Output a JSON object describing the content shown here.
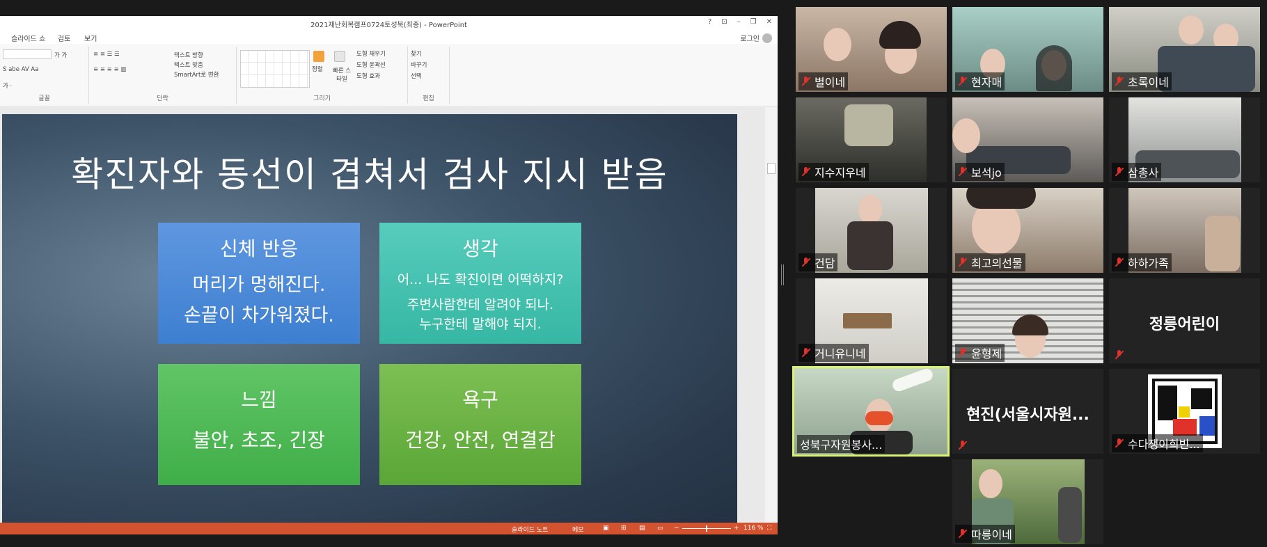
{
  "ppt": {
    "window_title": "2021재난회복캠프0724토성북(최종) - PowerPoint",
    "win_help": "?",
    "win_min": "–",
    "win_restore": "❐",
    "win_close": "✕",
    "menu": [
      "슬라이드 쇼",
      "검토",
      "보기"
    ],
    "login": "로그인",
    "ribbon": {
      "group_font": "글꼴",
      "group_paragraph": "단락",
      "group_drawing": "그리기",
      "group_edit": "편집",
      "text_direction": "텍스트 방향",
      "text_align": "텍스트 맞춤",
      "smartart": "SmartArt로 변환",
      "arrange": "정렬",
      "quick_styles": "빠른 스타일",
      "shape_fill": "도형 채우기",
      "shape_outline": "도형 윤곽선",
      "shape_effects": "도형 효과",
      "find": "찾기",
      "replace": "바꾸기",
      "select": "선택"
    },
    "statusbar": {
      "notes": "슬라이드 노트",
      "comments": "메모",
      "zoom": "116 %"
    }
  },
  "slide": {
    "title": "확진자와 동선이 겹쳐서 검사 지시 받음",
    "cards": [
      {
        "heading": "신체 반응",
        "lines": [
          "머리가 멍해진다.",
          "손끝이 차가워졌다."
        ]
      },
      {
        "heading": "생각",
        "lines": [
          "어... 나도 확진이면 어떡하지?",
          "주변사람한테 알려야 되나.",
          "누구한테 말해야 되지."
        ]
      },
      {
        "heading": "느낌",
        "lines": [
          "불안, 초조, 긴장"
        ]
      },
      {
        "heading": "욕구",
        "lines": [
          "건강, 안전, 연결감"
        ]
      }
    ]
  },
  "participants": [
    {
      "name": "별이네",
      "video": true
    },
    {
      "name": "현자매",
      "video": true
    },
    {
      "name": "초록이네",
      "video": true
    },
    {
      "name": "지수지우네",
      "video": true
    },
    {
      "name": "보석jo",
      "video": true
    },
    {
      "name": "삼총사",
      "video": true
    },
    {
      "name": "건담",
      "video": true
    },
    {
      "name": "최고의선물",
      "video": true
    },
    {
      "name": "하하가족",
      "video": true
    },
    {
      "name": "거니유니네",
      "video": true
    },
    {
      "name": "윤형제",
      "video": true
    },
    {
      "name": "정릉어린이",
      "video": false
    },
    {
      "name": "성북구자원봉사...",
      "video": true,
      "active": true
    },
    {
      "name": "현진(서울시자원...",
      "video": false
    },
    {
      "name": "수다쟁이희빈...",
      "video": true
    },
    {
      "name": "따릉이네",
      "video": true
    }
  ],
  "colors": {
    "active_speaker_border": "#d9f27a",
    "mic_muted": "#e0312a",
    "ppt_status": "#d35230"
  }
}
